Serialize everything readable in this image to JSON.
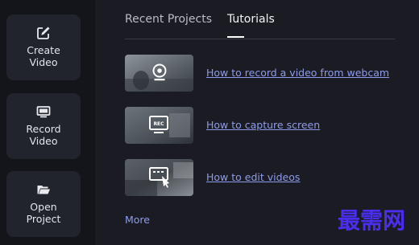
{
  "sidebar": {
    "items": [
      {
        "icon": "edit-icon",
        "label": "Create\nVideo"
      },
      {
        "icon": "monitor-icon",
        "label": "Record\nVideo"
      },
      {
        "icon": "folder-open-icon",
        "label": "Open\nProject"
      }
    ]
  },
  "tabs": [
    {
      "label": "Recent Projects",
      "active": false
    },
    {
      "label": "Tutorials",
      "active": true
    }
  ],
  "tutorials": [
    {
      "thumb_icon": "webcam-icon",
      "label": "How to record a video from webcam"
    },
    {
      "thumb_icon": "rec-screen-icon",
      "label": "How to capture screen"
    },
    {
      "thumb_icon": "edit-video-icon",
      "label": "How to edit videos"
    }
  ],
  "more_label": "More",
  "watermark": {
    "text": "最需网"
  },
  "colors": {
    "background": "#1b1c23",
    "sidebar": "#14151b",
    "button": "#22242d",
    "link": "#8e9bea",
    "watermark": "#4a2ef0"
  }
}
